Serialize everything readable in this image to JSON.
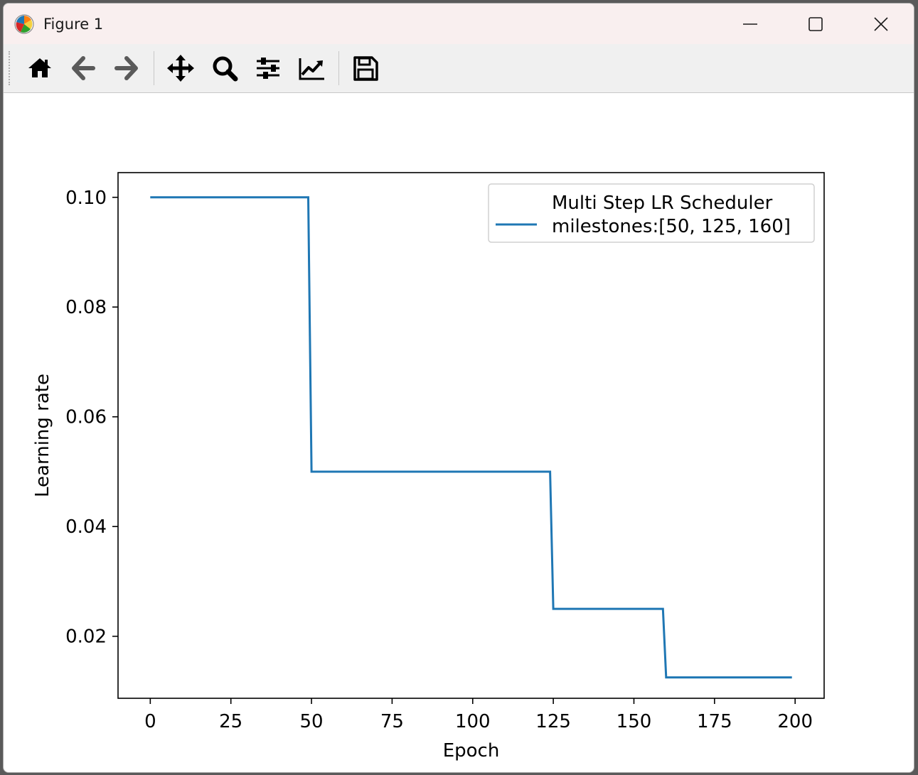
{
  "window": {
    "title": "Figure 1",
    "app_icon": "matplotlib-icon",
    "controls": {
      "minimize": "minimize-icon",
      "maximize": "maximize-icon",
      "close": "close-icon"
    }
  },
  "toolbar": {
    "buttons": [
      {
        "name": "home-button",
        "icon": "home-icon"
      },
      {
        "name": "back-button",
        "icon": "arrow-left-icon"
      },
      {
        "name": "forward-button",
        "icon": "arrow-right-icon"
      },
      {
        "name": "pan-button",
        "icon": "move-icon"
      },
      {
        "name": "zoom-button",
        "icon": "magnifier-icon"
      },
      {
        "name": "configure-subplots-button",
        "icon": "sliders-icon"
      },
      {
        "name": "edit-axis-button",
        "icon": "line-chart-icon"
      },
      {
        "name": "save-button",
        "icon": "floppy-disk-icon"
      }
    ]
  },
  "chart_data": {
    "type": "line",
    "xlabel": "Epoch",
    "ylabel": "Learning rate",
    "xlim": [
      -10,
      209
    ],
    "ylim": [
      0.0087,
      0.1045
    ],
    "xticks": [
      0,
      25,
      50,
      75,
      100,
      125,
      150,
      175,
      200
    ],
    "xtick_labels": [
      "0",
      "25",
      "50",
      "75",
      "100",
      "125",
      "150",
      "175",
      "200"
    ],
    "yticks": [
      0.02,
      0.04,
      0.06,
      0.08,
      0.1
    ],
    "ytick_labels": [
      "0.02",
      "0.04",
      "0.06",
      "0.08",
      "0.10"
    ],
    "grid": false,
    "legend_position": "top-right",
    "series": [
      {
        "name": "Multi Step LR Scheduler\nmilestones:[50, 125, 160]",
        "color": "#1f77b4",
        "points": [
          [
            0,
            0.1
          ],
          [
            49,
            0.1
          ],
          [
            50,
            0.05
          ],
          [
            124,
            0.05
          ],
          [
            125,
            0.025
          ],
          [
            159,
            0.025
          ],
          [
            160,
            0.0125
          ],
          [
            199,
            0.0125
          ]
        ]
      }
    ]
  }
}
